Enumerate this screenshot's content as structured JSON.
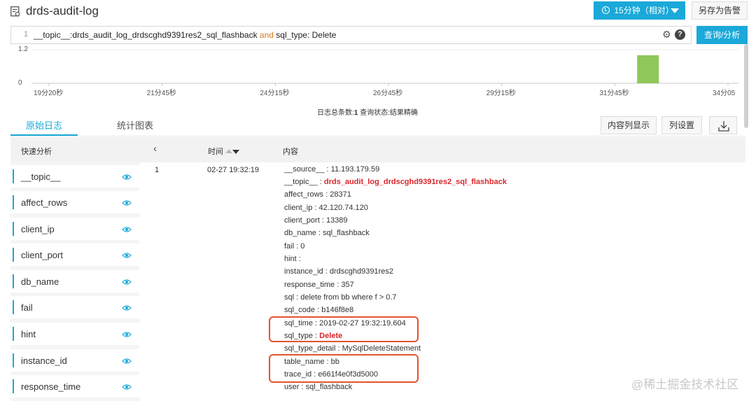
{
  "header": {
    "title": "drds-audit-log",
    "time_range_label": "15分钟（相对）",
    "save_alert_label": "另存为告警"
  },
  "query": {
    "line_number": "1",
    "text_part1": "__topic__:drds_audit_log_drdscghd9391res2_sql_flashback ",
    "keyword": "and",
    "text_part2": " sql_type: Delete",
    "search_label": "查询/分析"
  },
  "chart_data": {
    "type": "bar",
    "x": [
      "19分20秒",
      "21分45秒",
      "24分15秒",
      "26分45秒",
      "29分15秒",
      "31分45秒",
      "34分05"
    ],
    "y_ticks": [
      "1.2",
      "0"
    ],
    "ylim": [
      0,
      1.2
    ],
    "bars": [
      {
        "x_label": "32分10秒",
        "value": 1
      }
    ],
    "color": "#8fc75a"
  },
  "summary": {
    "count_label": "日志总条数:",
    "count_value": "1",
    "status_label": "查询状态:",
    "status_value": "结果精确"
  },
  "tabs": {
    "raw_log": "原始日志",
    "stats_chart": "统计图表"
  },
  "toolbar": {
    "content_col_display": "内容列显示",
    "col_settings": "列设置"
  },
  "table": {
    "quick_analysis": "快速分析",
    "time_header": "时间",
    "content_header": "内容"
  },
  "sidebar": {
    "items": [
      {
        "label": "__topic__"
      },
      {
        "label": "affect_rows"
      },
      {
        "label": "client_ip"
      },
      {
        "label": "client_port"
      },
      {
        "label": "db_name"
      },
      {
        "label": "fail"
      },
      {
        "label": "hint"
      },
      {
        "label": "instance_id"
      },
      {
        "label": "response_time"
      }
    ]
  },
  "log": {
    "index": "1",
    "time": "02-27 19:32:19",
    "fields": [
      {
        "key": "__source__",
        "value": "11.193.179.59"
      },
      {
        "key": "__topic__",
        "value": "drds_audit_log_drdscghd9391res2_sql_flashback"
      },
      {
        "key": "affect_rows",
        "value": "28371"
      },
      {
        "key": "client_ip",
        "value": "42.120.74.120"
      },
      {
        "key": "client_port",
        "value": "13389"
      },
      {
        "key": "db_name",
        "value": "sql_flashback"
      },
      {
        "key": "fail",
        "value": "0"
      },
      {
        "key": "hint",
        "value": ""
      },
      {
        "key": "instance_id",
        "value": "drdscghd9391res2"
      },
      {
        "key": "response_time",
        "value": "357"
      },
      {
        "key": "sql",
        "value": "delete from bb where f > 0.7"
      },
      {
        "key": "sql_code",
        "value": "b146f8e8"
      },
      {
        "key": "sql_time",
        "value": "2019-02-27 19:32:19.604"
      },
      {
        "key": "sql_type",
        "value": "Delete"
      },
      {
        "key": "sql_type_detail",
        "value": "MySqlDeleteStatement"
      },
      {
        "key": "table_name",
        "value": "bb"
      },
      {
        "key": "trace_id",
        "value": "e661f4e0f3d5000"
      },
      {
        "key": "user",
        "value": "sql_flashback"
      }
    ]
  },
  "watermark": "@稀土掘金技术社区"
}
